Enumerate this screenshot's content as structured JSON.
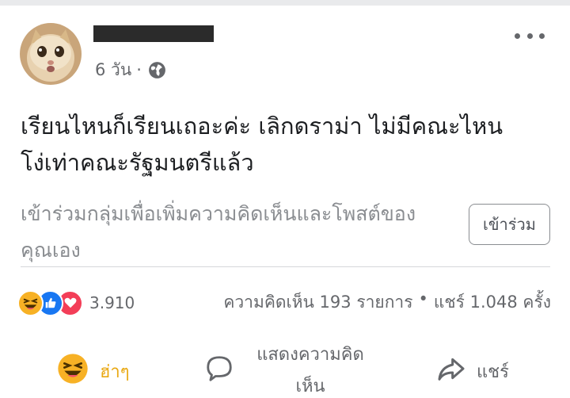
{
  "post": {
    "author_name": "redacted",
    "time": "6 วัน",
    "separator": "·",
    "privacy_icon": "globe-icon",
    "text_lines": [
      "เรียนไหนก็เรียนเถอะค่ะ เลิกดราม่า ไม่มีคณะไหน",
      "โง่เท่าคณะรัฐมนตรีแล้ว"
    ]
  },
  "join_group": {
    "prompt_lines": [
      "เข้าร่วมกลุ่มเพื่อเพิ่มความคิดเห็นและโพสต์ของ",
      "คุณเอง"
    ],
    "button_label": "เข้าร่วม"
  },
  "stats": {
    "reaction_icons": [
      "haha-icon",
      "like-icon",
      "love-icon"
    ],
    "reaction_count": "3.910",
    "comments": "ความคิดเห็น 193 รายการ",
    "separator": "•",
    "shares": "แชร์ 1.048 ครั้ง"
  },
  "actions": {
    "like_label": "ฮ่าๆ",
    "comment_label": "แสดงความคิดเห็น",
    "share_label": "แชร์"
  },
  "colors": {
    "haha": "#f7b125",
    "like": "#1877f2",
    "love": "#f33e58",
    "secondary_text": "#65676b"
  }
}
